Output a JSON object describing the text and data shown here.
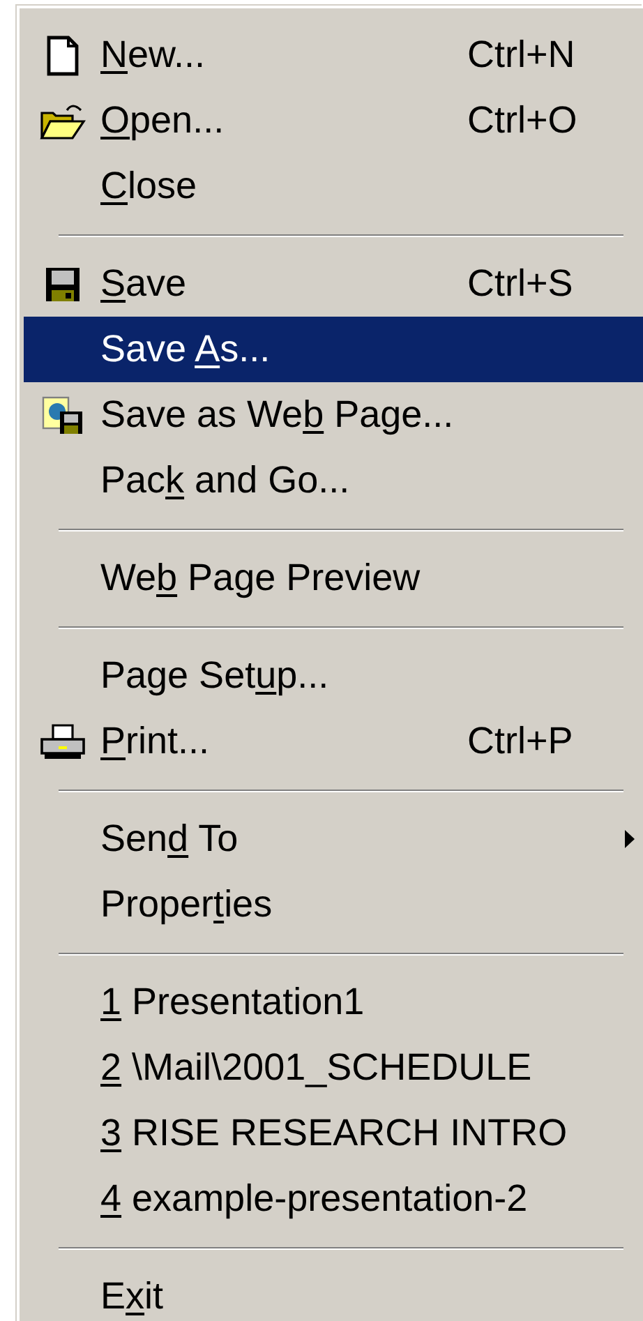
{
  "menu": {
    "items": [
      {
        "kind": "item",
        "label": {
          "key": "N",
          "after": "ew..."
        },
        "shortcut": "Ctrl+N",
        "selected": false
      },
      {
        "kind": "item",
        "label": {
          "key": "O",
          "after": "pen..."
        },
        "shortcut": "Ctrl+O",
        "selected": false
      },
      {
        "kind": "item",
        "label": {
          "key": "C",
          "after": "lose"
        },
        "selected": false
      },
      {
        "kind": "separator"
      },
      {
        "kind": "item",
        "label": {
          "key": "S",
          "after": "ave"
        },
        "shortcut": "Ctrl+S",
        "selected": false
      },
      {
        "kind": "item",
        "label": {
          "before": "Save ",
          "key": "A",
          "after": "s..."
        },
        "selected": true
      },
      {
        "kind": "item",
        "label": {
          "before": "Save as We",
          "key": "b",
          "after": " Page..."
        },
        "selected": false
      },
      {
        "kind": "item",
        "label": {
          "before": "Pac",
          "key": "k",
          "after": " and Go..."
        },
        "selected": false
      },
      {
        "kind": "separator"
      },
      {
        "kind": "item",
        "label": {
          "before": "We",
          "key": "b",
          "after": " Page Preview"
        },
        "selected": false
      },
      {
        "kind": "separator"
      },
      {
        "kind": "item",
        "label": {
          "before": "Page Set",
          "key": "u",
          "after": "p..."
        },
        "selected": false
      },
      {
        "kind": "item",
        "label": {
          "key": "P",
          "after": "rint..."
        },
        "shortcut": "Ctrl+P",
        "selected": false
      },
      {
        "kind": "separator"
      },
      {
        "kind": "item",
        "label": {
          "before": "Sen",
          "key": "d",
          "after": " To"
        },
        "submenu": true,
        "selected": false
      },
      {
        "kind": "item",
        "label": {
          "before": "Proper",
          "key": "t",
          "after": "ies"
        },
        "selected": false
      },
      {
        "kind": "separator"
      },
      {
        "kind": "item",
        "label": {
          "key": "1",
          "after": " Presentation1"
        },
        "selected": false
      },
      {
        "kind": "item",
        "label": {
          "key": "2",
          "after": " \\Mail\\2001_SCHEDULE"
        },
        "selected": false
      },
      {
        "kind": "item",
        "label": {
          "key": "3",
          "after": " RISE RESEARCH INTRO"
        },
        "selected": false
      },
      {
        "kind": "item",
        "label": {
          "key": "4",
          "after": " example-presentation-2"
        },
        "selected": false
      },
      {
        "kind": "separator"
      },
      {
        "kind": "item",
        "label": {
          "before": "E",
          "key": "x",
          "after": "it"
        },
        "selected": false
      }
    ]
  }
}
